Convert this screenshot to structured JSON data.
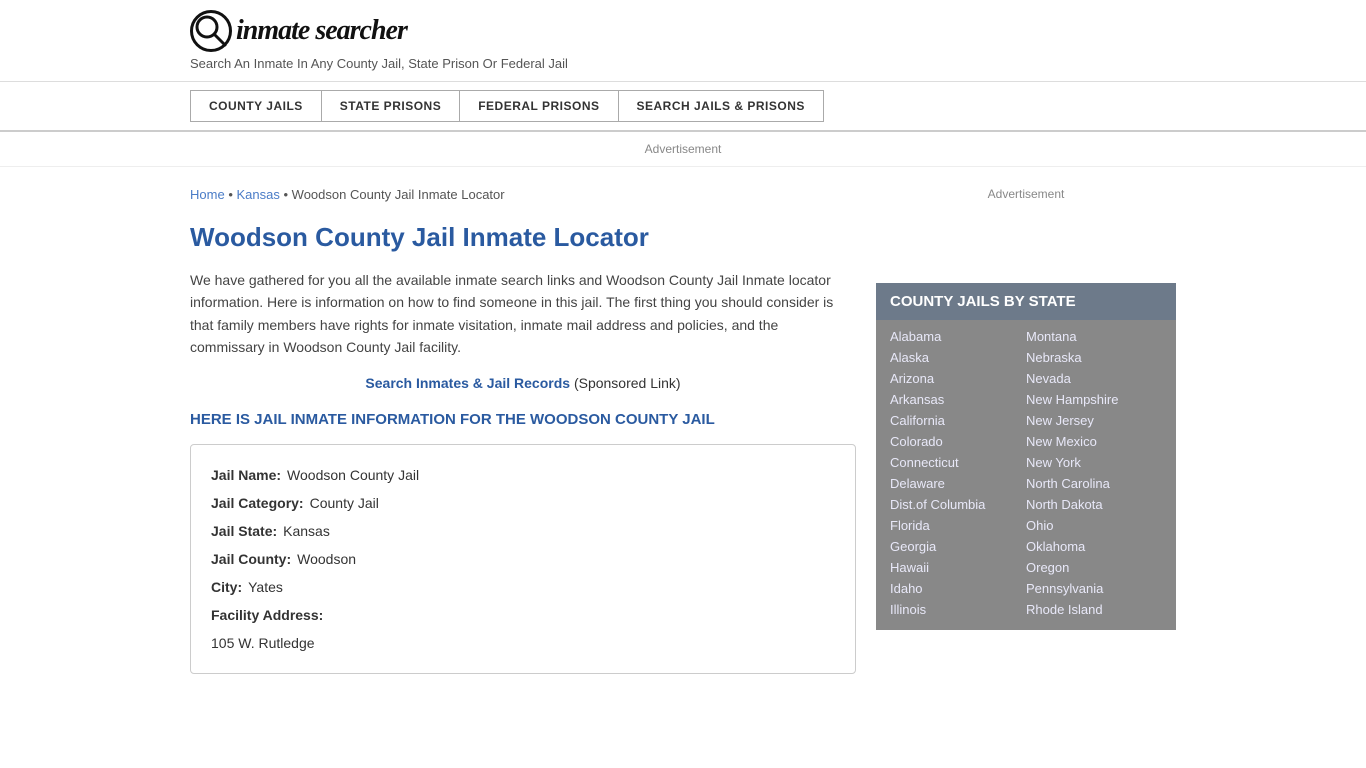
{
  "header": {
    "logo_icon": "🔍",
    "logo_text": "inmate searcher",
    "tagline": "Search An Inmate In Any County Jail, State Prison Or Federal Jail"
  },
  "nav": {
    "buttons": [
      {
        "label": "COUNTY JAILS",
        "id": "county-jails"
      },
      {
        "label": "STATE PRISONS",
        "id": "state-prisons"
      },
      {
        "label": "FEDERAL PRISONS",
        "id": "federal-prisons"
      },
      {
        "label": "SEARCH JAILS & PRISONS",
        "id": "search-jails-prisons"
      }
    ]
  },
  "ad": {
    "banner_text": "Advertisement"
  },
  "breadcrumb": {
    "home": "Home",
    "separator1": " • ",
    "state": "Kansas",
    "separator2": " • ",
    "current": "Woodson County Jail Inmate Locator"
  },
  "page": {
    "title": "Woodson County Jail Inmate Locator",
    "description": "We have gathered for you all the available inmate search links and Woodson County Jail Inmate locator information. Here is information on how to find someone in this jail. The first thing you should consider is that family members have rights for inmate visitation, inmate mail address and policies, and the commissary in Woodson County Jail facility.",
    "sponsored_link_text": "Search Inmates & Jail Records",
    "sponsored_label": "(Sponsored Link)",
    "info_heading": "HERE IS JAIL INMATE INFORMATION FOR THE WOODSON COUNTY JAIL"
  },
  "jail_info": {
    "name_label": "Jail Name:",
    "name_value": "Woodson County Jail",
    "category_label": "Jail Category:",
    "category_value": "County Jail",
    "state_label": "Jail State:",
    "state_value": "Kansas",
    "county_label": "Jail County:",
    "county_value": "Woodson",
    "city_label": "City:",
    "city_value": "Yates",
    "address_label": "Facility Address:",
    "address_value": "105 W. Rutledge"
  },
  "sidebar": {
    "ad_text": "Advertisement",
    "state_box_title": "COUNTY JAILS BY STATE",
    "states_left": [
      "Alabama",
      "Alaska",
      "Arizona",
      "Arkansas",
      "California",
      "Colorado",
      "Connecticut",
      "Delaware",
      "Dist.of Columbia",
      "Florida",
      "Georgia",
      "Hawaii",
      "Idaho",
      "Illinois"
    ],
    "states_right": [
      "Montana",
      "Nebraska",
      "Nevada",
      "New Hampshire",
      "New Jersey",
      "New Mexico",
      "New York",
      "North Carolina",
      "North Dakota",
      "Ohio",
      "Oklahoma",
      "Oregon",
      "Pennsylvania",
      "Rhode Island"
    ]
  }
}
